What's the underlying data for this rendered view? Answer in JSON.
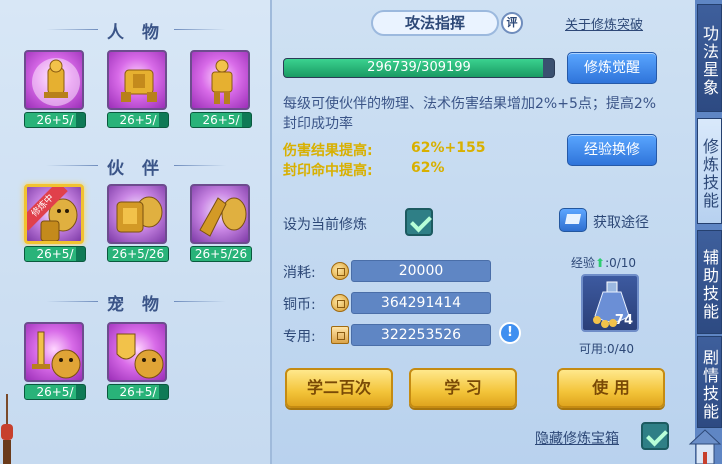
{
  "left": {
    "characters": {
      "title": "人 物",
      "slots": [
        {
          "level": "26+5/",
          "progress": 0.85,
          "icon": "golden-armor-icon"
        },
        {
          "level": "26+5/",
          "progress": 0.85,
          "icon": "golden-armor-icon"
        },
        {
          "level": "26+5/",
          "progress": 0.85,
          "icon": "golden-armor-icon"
        }
      ]
    },
    "partners": {
      "title": "伙 伴",
      "slots": [
        {
          "level": "26+5/",
          "progress": 0.85,
          "icon": "beast-armor-icon",
          "tag": "修炼中"
        },
        {
          "level": "26+5/26",
          "progress": 1.0,
          "icon": "beast-armor-icon"
        },
        {
          "level": "26+5/26",
          "progress": 1.0,
          "icon": "beast-gauntlet-icon"
        }
      ]
    },
    "pets": {
      "title": "宠 物",
      "slots": [
        {
          "level": "26+5/",
          "progress": 0.85,
          "icon": "pet-sword-icon"
        },
        {
          "level": "26+5/",
          "progress": 0.85,
          "icon": "pet-shield-icon"
        }
      ]
    }
  },
  "main": {
    "tab_title": "攻法指挥",
    "comment_badge": "评",
    "link_breakthrough": "关于修炼突破",
    "exp_text": "296739/309199",
    "exp_progress": 0.96,
    "btn_awaken": "修炼觉醒",
    "description": "每级可使伙伴的物理、法术伤害结果增加2%+5点；提高2%封印成功率",
    "stats": [
      {
        "label": "伤害结果提高:",
        "value": "62%+155"
      },
      {
        "label": "封印命中提高:",
        "value": "62%"
      }
    ],
    "btn_exchange": "经验换修",
    "set_current_label": "设为当前修炼",
    "obtain_label": "获取途径",
    "costs": [
      {
        "label": "消耗:",
        "value": "20000"
      },
      {
        "label": "铜币:",
        "value": "364291414"
      },
      {
        "label": "专用:",
        "value": "322253526"
      }
    ],
    "info_icon": "!",
    "exp_counter": "经验",
    "exp_counter_value": ":0/10",
    "item_count": "74",
    "usable": "可用:0/40",
    "btn_learn_200": "学二百次",
    "btn_learn": "学 习",
    "btn_use": "使 用",
    "hide_chest_label": "隐藏修炼宝箱"
  },
  "right_tabs": [
    {
      "label": "功法星象",
      "active": false
    },
    {
      "label": "修炼技能",
      "active": true
    },
    {
      "label": "辅助技能",
      "active": false
    },
    {
      "label": "剧情技能",
      "active": false
    }
  ],
  "colors": {
    "accent_gold": "#f3c43a",
    "accent_blue": "#2f74da",
    "bar_green": "#29b379",
    "stat_yellow": "#d8b000"
  }
}
